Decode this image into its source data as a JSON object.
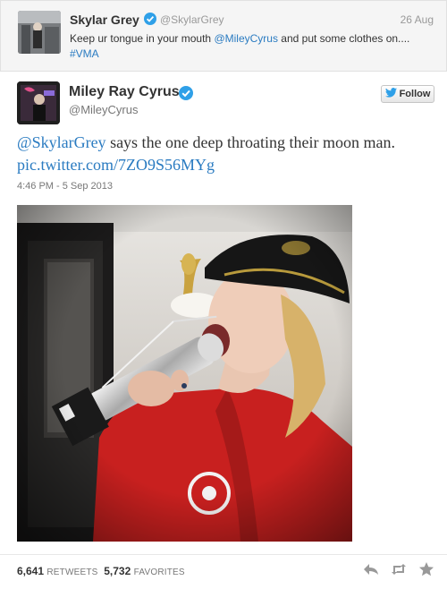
{
  "parent_tweet": {
    "name": "Skylar Grey",
    "handle": "@SkylarGrey",
    "date": "26 Aug",
    "text_before": "Keep ur tongue in your mouth ",
    "mention": "@MileyCyrus",
    "text_after": " and put some clothes on....",
    "hashtag": "#VMA"
  },
  "tweet": {
    "name": "Miley Ray Cyrus",
    "handle": "@MileyCyrus",
    "follow_label": "Follow",
    "mention": "@SkylarGrey",
    "text": " says the one deep throating their moon man. ",
    "link": "pic.twitter.com/7ZO9S56MYg",
    "timestamp": "4:46 PM - 5 Sep 2013"
  },
  "stats": {
    "retweets_count": "6,641",
    "retweets_label": "RETWEETS",
    "favorites_count": "5,732",
    "favorites_label": "FAVORITES"
  },
  "colors": {
    "link": "#2a7bc1",
    "verified": "#2fa0e8",
    "jacket": "#c8201f",
    "icon_gray": "#999999"
  },
  "icons": [
    "verified-badge-icon",
    "twitter-bird-icon",
    "reply-icon",
    "retweet-icon",
    "favorite-star-icon"
  ]
}
